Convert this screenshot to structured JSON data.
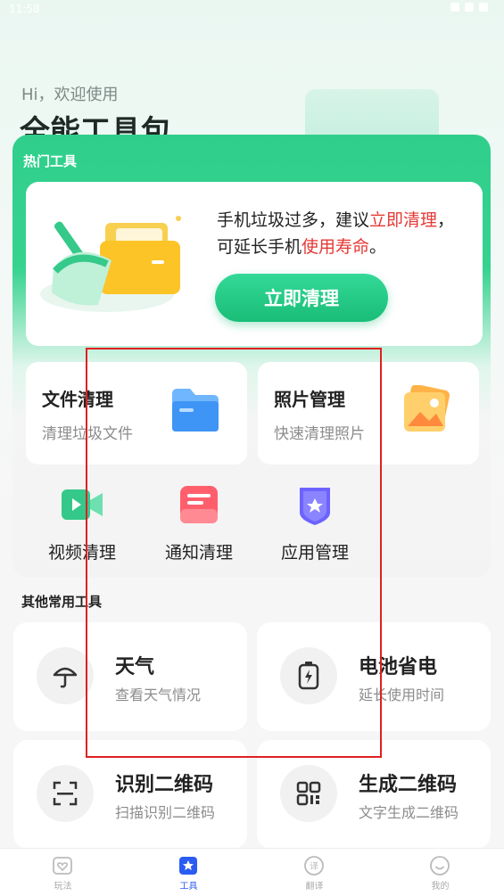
{
  "status_bar": {
    "time": "11:58"
  },
  "header": {
    "greeting": "Hi，欢迎使用",
    "title": "全能工具包"
  },
  "hot_tools": {
    "title": "热门工具",
    "banner": {
      "line1_prefix": "手机垃圾过多，建议",
      "line1_highlight": "立即清理",
      "line1_suffix": "，",
      "line2_prefix": "可延长手机",
      "line2_highlight": "使用寿命",
      "line2_suffix": "。",
      "button": "立即清理"
    },
    "tiles": [
      {
        "title": "文件清理",
        "subtitle": "清理垃圾文件",
        "icon": "folder-icon"
      },
      {
        "title": "照片管理",
        "subtitle": "快速清理照片",
        "icon": "photo-icon"
      }
    ],
    "minis": [
      {
        "label": "视频清理",
        "icon": "video-icon"
      },
      {
        "label": "通知清理",
        "icon": "notification-icon"
      },
      {
        "label": "应用管理",
        "icon": "app-manage-icon"
      }
    ]
  },
  "other_tools": {
    "title": "其他常用工具",
    "items": [
      {
        "title": "天气",
        "subtitle": "查看天气情况",
        "icon": "umbrella-icon"
      },
      {
        "title": "电池省电",
        "subtitle": "延长使用时间",
        "icon": "battery-icon"
      },
      {
        "title": "识别二维码",
        "subtitle": "扫描识别二维码",
        "icon": "scan-icon"
      },
      {
        "title": "生成二维码",
        "subtitle": "文字生成二维码",
        "icon": "qrcode-icon"
      }
    ]
  },
  "tabbar": {
    "tabs": [
      {
        "label": "玩法",
        "active": false
      },
      {
        "label": "工具",
        "active": true
      },
      {
        "label": "翻译",
        "active": false
      },
      {
        "label": "我的",
        "active": false
      }
    ]
  },
  "colors": {
    "accent": "#2fcf8b",
    "highlight": "#e53935",
    "active_tab": "#2a5cf2"
  }
}
